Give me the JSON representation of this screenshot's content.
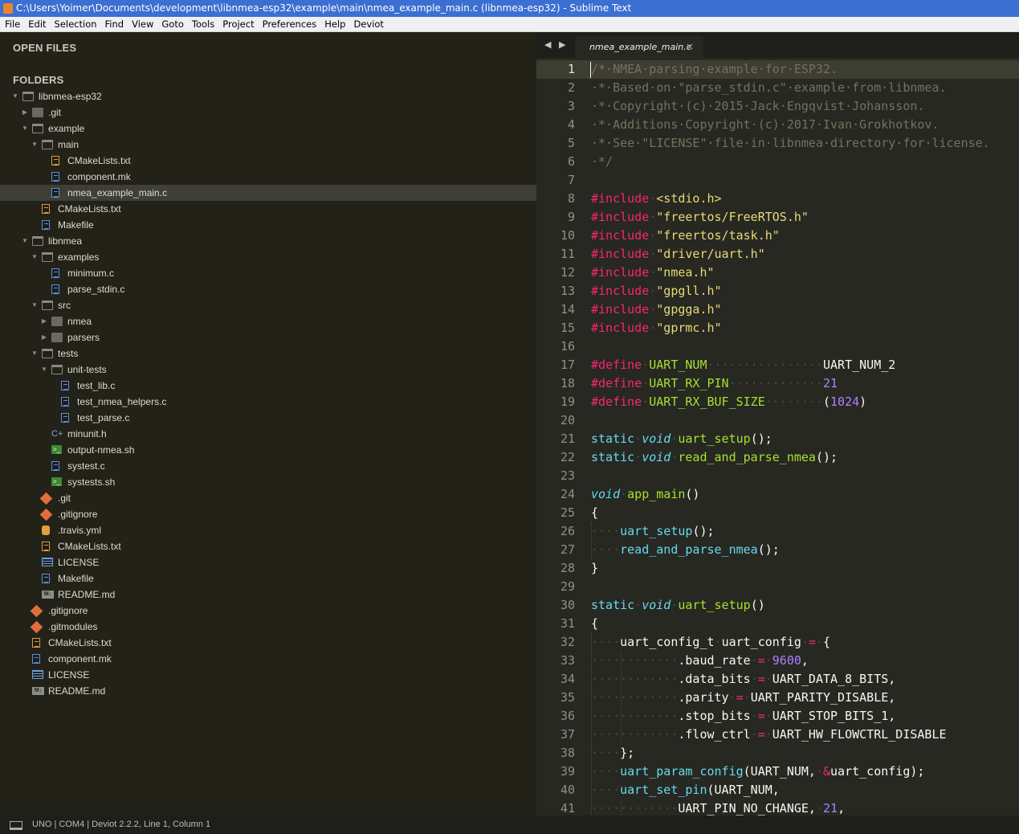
{
  "window": {
    "title": "C:\\Users\\Yoimer\\Documents\\development\\libnmea-esp32\\example\\main\\nmea_example_main.c (libnmea-esp32) - Sublime Text"
  },
  "menu": [
    "File",
    "Edit",
    "Selection",
    "Find",
    "View",
    "Goto",
    "Tools",
    "Project",
    "Preferences",
    "Help",
    "Deviot"
  ],
  "sidebar": {
    "open_files_label": "OPEN FILES",
    "folders_label": "FOLDERS",
    "tree": [
      {
        "label": "libnmea-esp32",
        "depth": 0,
        "kind": "folder-open",
        "twisty": "open"
      },
      {
        "label": ".git",
        "depth": 1,
        "kind": "folder",
        "twisty": "closed"
      },
      {
        "label": "example",
        "depth": 1,
        "kind": "folder-open",
        "twisty": "open"
      },
      {
        "label": "main",
        "depth": 2,
        "kind": "folder-open",
        "twisty": "open"
      },
      {
        "label": "CMakeLists.txt",
        "depth": 3,
        "kind": "txt"
      },
      {
        "label": "component.mk",
        "depth": 3,
        "kind": "file"
      },
      {
        "label": "nmea_example_main.c",
        "depth": 3,
        "kind": "file",
        "selected": true
      },
      {
        "label": "CMakeLists.txt",
        "depth": 2,
        "kind": "txt"
      },
      {
        "label": "Makefile",
        "depth": 2,
        "kind": "file"
      },
      {
        "label": "libnmea",
        "depth": 1,
        "kind": "folder-open",
        "twisty": "open"
      },
      {
        "label": "examples",
        "depth": 2,
        "kind": "folder-open",
        "twisty": "open"
      },
      {
        "label": "minimum.c",
        "depth": 3,
        "kind": "file"
      },
      {
        "label": "parse_stdin.c",
        "depth": 3,
        "kind": "file"
      },
      {
        "label": "src",
        "depth": 2,
        "kind": "folder-open",
        "twisty": "open"
      },
      {
        "label": "nmea",
        "depth": 3,
        "kind": "folder",
        "twisty": "closed"
      },
      {
        "label": "parsers",
        "depth": 3,
        "kind": "folder",
        "twisty": "closed"
      },
      {
        "label": "tests",
        "depth": 2,
        "kind": "folder-open",
        "twisty": "open"
      },
      {
        "label": "unit-tests",
        "depth": 3,
        "kind": "folder-open",
        "twisty": "open"
      },
      {
        "label": "test_lib.c",
        "depth": 4,
        "kind": "file"
      },
      {
        "label": "test_nmea_helpers.c",
        "depth": 4,
        "kind": "file"
      },
      {
        "label": "test_parse.c",
        "depth": 4,
        "kind": "file"
      },
      {
        "label": "minunit.h",
        "depth": 3,
        "kind": "header"
      },
      {
        "label": "output-nmea.sh",
        "depth": 3,
        "kind": "shell"
      },
      {
        "label": "systest.c",
        "depth": 3,
        "kind": "file"
      },
      {
        "label": "systests.sh",
        "depth": 3,
        "kind": "shell"
      },
      {
        "label": ".git",
        "depth": 2,
        "kind": "git"
      },
      {
        "label": ".gitignore",
        "depth": 2,
        "kind": "git"
      },
      {
        "label": ".travis.yml",
        "depth": 2,
        "kind": "yml"
      },
      {
        "label": "CMakeLists.txt",
        "depth": 2,
        "kind": "txt"
      },
      {
        "label": "LICENSE",
        "depth": 2,
        "kind": "license"
      },
      {
        "label": "Makefile",
        "depth": 2,
        "kind": "file"
      },
      {
        "label": "README.md",
        "depth": 2,
        "kind": "md"
      },
      {
        "label": ".gitignore",
        "depth": 1,
        "kind": "git"
      },
      {
        "label": ".gitmodules",
        "depth": 1,
        "kind": "git"
      },
      {
        "label": "CMakeLists.txt",
        "depth": 1,
        "kind": "txt"
      },
      {
        "label": "component.mk",
        "depth": 1,
        "kind": "file"
      },
      {
        "label": "LICENSE",
        "depth": 1,
        "kind": "license"
      },
      {
        "label": "README.md",
        "depth": 1,
        "kind": "md"
      }
    ]
  },
  "tabs": {
    "nav": "◀ ▶",
    "active": {
      "label": "nmea_example_main.c",
      "close": "×"
    }
  },
  "editor": {
    "active_line": 1,
    "lines": [
      [
        [
          "c-com",
          "/*·NMEA·parsing·example·for·ESP32."
        ]
      ],
      [
        [
          "c-com",
          "·*·Based·on·\"parse_stdin.c\"·example·from·libnmea."
        ]
      ],
      [
        [
          "c-com",
          "·*·Copyright·(c)·2015·Jack·Engqvist·Johansson."
        ]
      ],
      [
        [
          "c-com",
          "·*·Additions·Copyright·(c)·2017·Ivan·Grokhotkov."
        ]
      ],
      [
        [
          "c-com",
          "·*·See·\"LICENSE\"·file·in·libnmea·directory·for·license."
        ]
      ],
      [
        [
          "c-com",
          "·*/"
        ]
      ],
      [],
      [
        [
          "c-kw",
          "#include"
        ],
        [
          "c-ws",
          "·"
        ],
        [
          "c-str",
          "<stdio.h>"
        ]
      ],
      [
        [
          "c-kw",
          "#include"
        ],
        [
          "c-ws",
          "·"
        ],
        [
          "c-str",
          "\"freertos/FreeRTOS.h\""
        ]
      ],
      [
        [
          "c-kw",
          "#include"
        ],
        [
          "c-ws",
          "·"
        ],
        [
          "c-str",
          "\"freertos/task.h\""
        ]
      ],
      [
        [
          "c-kw",
          "#include"
        ],
        [
          "c-ws",
          "·"
        ],
        [
          "c-str",
          "\"driver/uart.h\""
        ]
      ],
      [
        [
          "c-kw",
          "#include"
        ],
        [
          "c-ws",
          "·"
        ],
        [
          "c-str",
          "\"nmea.h\""
        ]
      ],
      [
        [
          "c-kw",
          "#include"
        ],
        [
          "c-ws",
          "·"
        ],
        [
          "c-str",
          "\"gpgll.h\""
        ]
      ],
      [
        [
          "c-kw",
          "#include"
        ],
        [
          "c-ws",
          "·"
        ],
        [
          "c-str",
          "\"gpgga.h\""
        ]
      ],
      [
        [
          "c-kw",
          "#include"
        ],
        [
          "c-ws",
          "·"
        ],
        [
          "c-str",
          "\"gprmc.h\""
        ]
      ],
      [],
      [
        [
          "c-kw",
          "#define"
        ],
        [
          "c-ws",
          "·"
        ],
        [
          "c-fn",
          "UART_NUM"
        ],
        [
          "c-ws",
          "················"
        ],
        [
          "c-pl",
          "UART_NUM_2"
        ]
      ],
      [
        [
          "c-kw",
          "#define"
        ],
        [
          "c-ws",
          "·"
        ],
        [
          "c-fn",
          "UART_RX_PIN"
        ],
        [
          "c-ws",
          "·············"
        ],
        [
          "c-num",
          "21"
        ]
      ],
      [
        [
          "c-kw",
          "#define"
        ],
        [
          "c-ws",
          "·"
        ],
        [
          "c-fn",
          "UART_RX_BUF_SIZE"
        ],
        [
          "c-ws",
          "········"
        ],
        [
          "c-pl",
          "("
        ],
        [
          "c-num",
          "1024"
        ],
        [
          "c-pl",
          ")"
        ]
      ],
      [],
      [
        [
          "c-st",
          "static"
        ],
        [
          "c-ws",
          "·"
        ],
        [
          "c-ty",
          "void"
        ],
        [
          "c-ws",
          "·"
        ],
        [
          "c-fn",
          "uart_setup"
        ],
        [
          "c-pl",
          "();"
        ]
      ],
      [
        [
          "c-st",
          "static"
        ],
        [
          "c-ws",
          "·"
        ],
        [
          "c-ty",
          "void"
        ],
        [
          "c-ws",
          "·"
        ],
        [
          "c-fn",
          "read_and_parse_nmea"
        ],
        [
          "c-pl",
          "();"
        ]
      ],
      [],
      [
        [
          "c-ty",
          "void"
        ],
        [
          "c-ws",
          "·"
        ],
        [
          "c-fn",
          "app_main"
        ],
        [
          "c-pl",
          "()"
        ]
      ],
      [
        [
          "c-pl",
          "{"
        ]
      ],
      [
        [
          "c-ws",
          "····"
        ],
        [
          "c-st",
          "uart_setup"
        ],
        [
          "c-pl",
          "();"
        ]
      ],
      [
        [
          "c-ws",
          "····"
        ],
        [
          "c-st",
          "read_and_parse_nmea"
        ],
        [
          "c-pl",
          "();"
        ]
      ],
      [
        [
          "c-pl",
          "}"
        ]
      ],
      [],
      [
        [
          "c-st",
          "static"
        ],
        [
          "c-ws",
          "·"
        ],
        [
          "c-ty",
          "void"
        ],
        [
          "c-ws",
          "·"
        ],
        [
          "c-fn",
          "uart_setup"
        ],
        [
          "c-pl",
          "()"
        ]
      ],
      [
        [
          "c-pl",
          "{"
        ]
      ],
      [
        [
          "c-ws",
          "····"
        ],
        [
          "c-pl",
          "uart_config_t"
        ],
        [
          "c-ws",
          "·"
        ],
        [
          "c-pl",
          "uart_config"
        ],
        [
          "c-ws",
          "·"
        ],
        [
          "c-op",
          "="
        ],
        [
          "c-ws",
          "·"
        ],
        [
          "c-pl",
          "{"
        ]
      ],
      [
        [
          "c-ws",
          "············"
        ],
        [
          "c-pl",
          ".baud_rate"
        ],
        [
          "c-ws",
          "·"
        ],
        [
          "c-op",
          "="
        ],
        [
          "c-ws",
          "·"
        ],
        [
          "c-num",
          "9600"
        ],
        [
          "c-pl",
          ","
        ]
      ],
      [
        [
          "c-ws",
          "············"
        ],
        [
          "c-pl",
          ".data_bits"
        ],
        [
          "c-ws",
          "·"
        ],
        [
          "c-op",
          "="
        ],
        [
          "c-ws",
          "·"
        ],
        [
          "c-pl",
          "UART_DATA_8_BITS,"
        ]
      ],
      [
        [
          "c-ws",
          "············"
        ],
        [
          "c-pl",
          ".parity"
        ],
        [
          "c-ws",
          "·"
        ],
        [
          "c-op",
          "="
        ],
        [
          "c-ws",
          "·"
        ],
        [
          "c-pl",
          "UART_PARITY_DISABLE,"
        ]
      ],
      [
        [
          "c-ws",
          "············"
        ],
        [
          "c-pl",
          ".stop_bits"
        ],
        [
          "c-ws",
          "·"
        ],
        [
          "c-op",
          "="
        ],
        [
          "c-ws",
          "·"
        ],
        [
          "c-pl",
          "UART_STOP_BITS_1,"
        ]
      ],
      [
        [
          "c-ws",
          "············"
        ],
        [
          "c-pl",
          ".flow_ctrl"
        ],
        [
          "c-ws",
          "·"
        ],
        [
          "c-op",
          "="
        ],
        [
          "c-ws",
          "·"
        ],
        [
          "c-pl",
          "UART_HW_FLOWCTRL_DISABLE"
        ]
      ],
      [
        [
          "c-ws",
          "····"
        ],
        [
          "c-pl",
          "};"
        ]
      ],
      [
        [
          "c-ws",
          "····"
        ],
        [
          "c-st",
          "uart_param_config"
        ],
        [
          "c-pl",
          "(UART_NUM,"
        ],
        [
          "c-ws",
          "·"
        ],
        [
          "c-op",
          "&"
        ],
        [
          "c-pl",
          "uart_config);"
        ]
      ],
      [
        [
          "c-ws",
          "····"
        ],
        [
          "c-st",
          "uart_set_pin"
        ],
        [
          "c-pl",
          "(UART_NUM,"
        ]
      ],
      [
        [
          "c-ws",
          "············"
        ],
        [
          "c-pl",
          "UART_PIN_NO_CHANGE,"
        ],
        [
          "c-ws",
          "·"
        ],
        [
          "c-num",
          "21"
        ],
        [
          "c-pl",
          ","
        ]
      ]
    ]
  },
  "status": {
    "text": "UNO | COM4 | Deviot 2.2.2, Line 1, Column 1"
  }
}
